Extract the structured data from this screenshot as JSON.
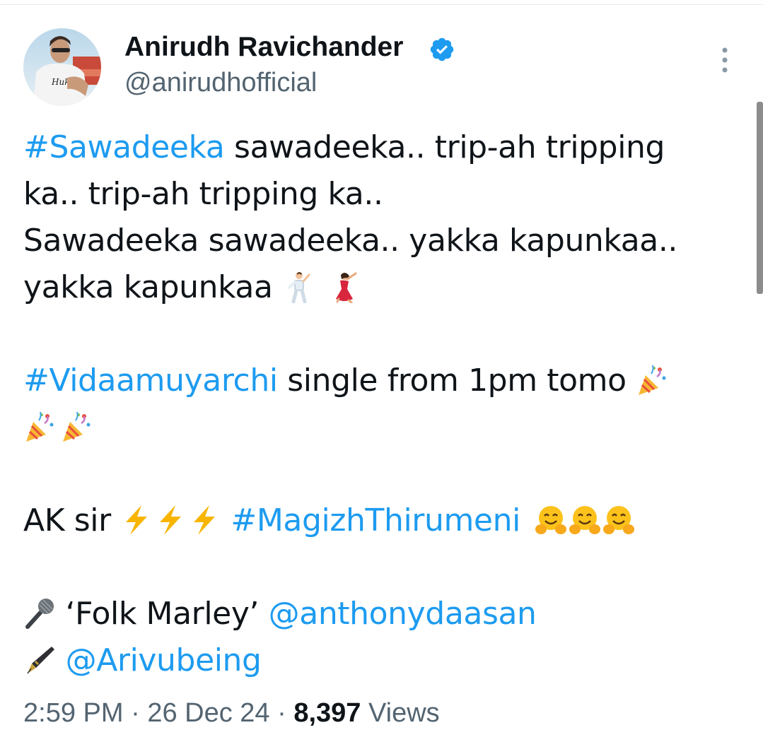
{
  "author": {
    "display_name": "Anirudh Ravichander",
    "handle": "@anirudhofficial",
    "verified": true,
    "avatar_shirt_text": "Hukum"
  },
  "icons": {
    "verified": "verified-badge-icon",
    "more": "more-vertical-icon",
    "dancer_man": "man-dancing-emoji",
    "dancer_woman": "woman-dancing-emoji",
    "party": "party-popper-emoji",
    "bolt": "high-voltage-emoji",
    "hug": "hugging-face-emoji",
    "mic": "microphone-emoji",
    "pen": "fountain-pen-emoji"
  },
  "tweet": {
    "line1": {
      "hashtag": "#Sawadeeka",
      "text": " sawadeeka.. trip-ah tripping"
    },
    "line2": {
      "text": "ka.. trip-ah tripping ka.."
    },
    "line3": {
      "text": "Sawadeeka sawadeeka.. yakka kapunkaa.."
    },
    "line4": {
      "text": "yakka kapunkaa "
    },
    "line5": {
      "hashtag": "#Vidaamuyarchi",
      "text": " single from 1pm tomo "
    },
    "line7": {
      "text": "AK sir ",
      "hashtag": "#MagizhThirumeni"
    },
    "line8": {
      "text": " ‘Folk Marley’ ",
      "mention": "@anthonydaasan"
    },
    "line9": {
      "text": " ",
      "mention": "@Arivubeing"
    }
  },
  "meta": {
    "time": "2:59 PM",
    "sep1": " · ",
    "date": "26 Dec 24",
    "sep2": " · ",
    "views_count": "8,397",
    "views_label": " Views"
  },
  "colors": {
    "link": "#1d9bf0",
    "verified": "#1d9bf0",
    "secondary_text": "#536471",
    "primary_text": "#0f1419"
  }
}
